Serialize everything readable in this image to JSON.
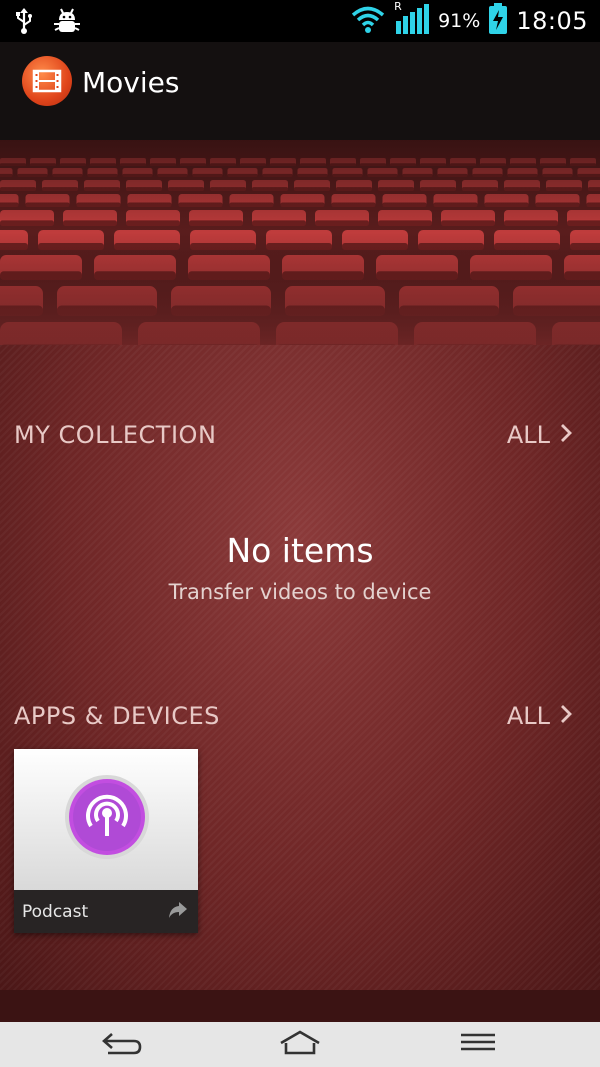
{
  "status_bar": {
    "battery_percent": "91%",
    "time": "18:05",
    "roaming_label": "R",
    "icons": [
      "usb-icon",
      "debug-icon",
      "wifi-icon",
      "signal-icon",
      "battery-charging-icon"
    ]
  },
  "action_bar": {
    "title": "Movies",
    "icon": "film-icon"
  },
  "collection": {
    "title": "MY COLLECTION",
    "all_label": "ALL",
    "empty_title": "No items",
    "empty_subtitle": "Transfer videos to device"
  },
  "apps_devices": {
    "title": "APPS & DEVICES",
    "all_label": "ALL",
    "items": [
      {
        "label": "Podcast",
        "icon": "podcast-icon"
      }
    ]
  },
  "nav_bar": {
    "buttons": [
      "back-icon",
      "home-icon",
      "menu-icon"
    ]
  },
  "colors": {
    "accent": "#e0451b",
    "background": "#6e2626",
    "podcast_purple": "#b04ad6"
  }
}
